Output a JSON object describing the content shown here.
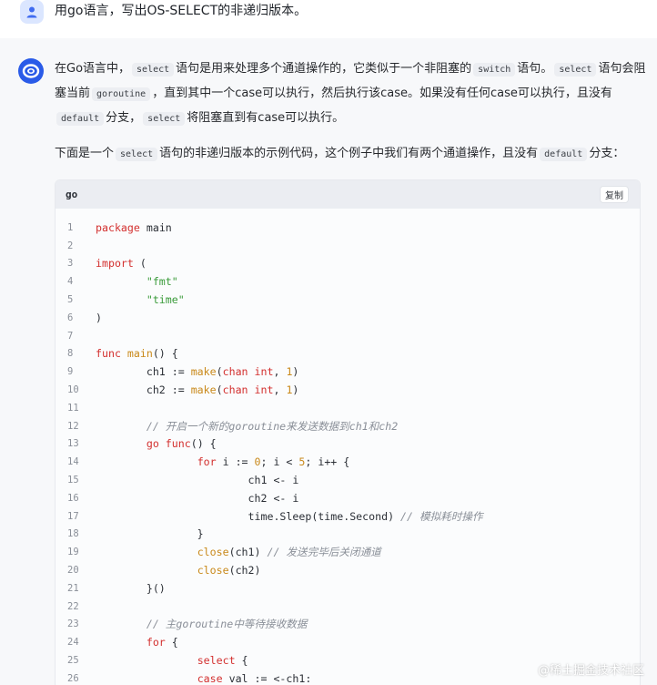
{
  "user": {
    "question": "用go语言，写出OS-SELECT的非递归版本。"
  },
  "answer": {
    "para1": [
      {
        "t": "text",
        "v": "在Go语言中，"
      },
      {
        "t": "code",
        "v": "select"
      },
      {
        "t": "text",
        "v": "语句是用来处理多个通道操作的，它类似于一个非阻塞的"
      },
      {
        "t": "code",
        "v": "switch"
      },
      {
        "t": "text",
        "v": "语句。"
      },
      {
        "t": "code",
        "v": "select"
      },
      {
        "t": "text",
        "v": "语句会阻塞当前"
      },
      {
        "t": "code",
        "v": "goroutine"
      },
      {
        "t": "text",
        "v": "，直到其中一个case可以执行，然后执行该case。如果没有任何case可以执行，且没有"
      },
      {
        "t": "code",
        "v": "default"
      },
      {
        "t": "text",
        "v": "分支，"
      },
      {
        "t": "code",
        "v": "select"
      },
      {
        "t": "text",
        "v": "将阻塞直到有case可以执行。"
      }
    ],
    "para2": [
      {
        "t": "text",
        "v": "下面是一个"
      },
      {
        "t": "code",
        "v": "select"
      },
      {
        "t": "text",
        "v": "语句的非递归版本的示例代码，这个例子中我们有两个通道操作，且没有"
      },
      {
        "t": "code",
        "v": "default"
      },
      {
        "t": "text",
        "v": "分支："
      }
    ]
  },
  "code": {
    "language": "go",
    "copy_label": "复制",
    "lines": [
      [
        {
          "c": "kw",
          "v": "package"
        },
        {
          "c": "ct",
          "v": " main"
        }
      ],
      [],
      [
        {
          "c": "kw",
          "v": "import"
        },
        {
          "c": "ct",
          "v": " ("
        }
      ],
      [
        {
          "c": "ct",
          "v": "        "
        },
        {
          "c": "str",
          "v": "\"fmt\""
        }
      ],
      [
        {
          "c": "ct",
          "v": "        "
        },
        {
          "c": "str",
          "v": "\"time\""
        }
      ],
      [
        {
          "c": "ct",
          "v": ")"
        }
      ],
      [],
      [
        {
          "c": "kw",
          "v": "func"
        },
        {
          "c": "ct",
          "v": " "
        },
        {
          "c": "fn",
          "v": "main"
        },
        {
          "c": "ct",
          "v": "() {"
        }
      ],
      [
        {
          "c": "ct",
          "v": "        ch1 := "
        },
        {
          "c": "fn",
          "v": "make"
        },
        {
          "c": "ct",
          "v": "("
        },
        {
          "c": "kw",
          "v": "chan"
        },
        {
          "c": "ct",
          "v": " "
        },
        {
          "c": "kw",
          "v": "int"
        },
        {
          "c": "ct",
          "v": ", "
        },
        {
          "c": "fn",
          "v": "1"
        },
        {
          "c": "ct",
          "v": ")"
        }
      ],
      [
        {
          "c": "ct",
          "v": "        ch2 := "
        },
        {
          "c": "fn",
          "v": "make"
        },
        {
          "c": "ct",
          "v": "("
        },
        {
          "c": "kw",
          "v": "chan"
        },
        {
          "c": "ct",
          "v": " "
        },
        {
          "c": "kw",
          "v": "int"
        },
        {
          "c": "ct",
          "v": ", "
        },
        {
          "c": "fn",
          "v": "1"
        },
        {
          "c": "ct",
          "v": ")"
        }
      ],
      [],
      [
        {
          "c": "ct",
          "v": "        "
        },
        {
          "c": "cm",
          "v": "// 开启一个新的goroutine来发送数据到ch1和ch2"
        }
      ],
      [
        {
          "c": "ct",
          "v": "        "
        },
        {
          "c": "kw",
          "v": "go"
        },
        {
          "c": "ct",
          "v": " "
        },
        {
          "c": "kw",
          "v": "func"
        },
        {
          "c": "ct",
          "v": "() {"
        }
      ],
      [
        {
          "c": "ct",
          "v": "                "
        },
        {
          "c": "kw",
          "v": "for"
        },
        {
          "c": "ct",
          "v": " i := "
        },
        {
          "c": "fn",
          "v": "0"
        },
        {
          "c": "ct",
          "v": "; i < "
        },
        {
          "c": "fn",
          "v": "5"
        },
        {
          "c": "ct",
          "v": "; i++ {"
        }
      ],
      [
        {
          "c": "ct",
          "v": "                        ch1 <- i"
        }
      ],
      [
        {
          "c": "ct",
          "v": "                        ch2 <- i"
        }
      ],
      [
        {
          "c": "ct",
          "v": "                        time.Sleep(time.Second) "
        },
        {
          "c": "cm",
          "v": "// 模拟耗时操作"
        }
      ],
      [
        {
          "c": "ct",
          "v": "                }"
        }
      ],
      [
        {
          "c": "ct",
          "v": "                "
        },
        {
          "c": "fn",
          "v": "close"
        },
        {
          "c": "ct",
          "v": "(ch1) "
        },
        {
          "c": "cm",
          "v": "// 发送完毕后关闭通道"
        }
      ],
      [
        {
          "c": "ct",
          "v": "                "
        },
        {
          "c": "fn",
          "v": "close"
        },
        {
          "c": "ct",
          "v": "(ch2)"
        }
      ],
      [
        {
          "c": "ct",
          "v": "        }()"
        }
      ],
      [],
      [
        {
          "c": "ct",
          "v": "        "
        },
        {
          "c": "cm",
          "v": "// 主goroutine中等待接收数据"
        }
      ],
      [
        {
          "c": "ct",
          "v": "        "
        },
        {
          "c": "kw",
          "v": "for"
        },
        {
          "c": "ct",
          "v": " {"
        }
      ],
      [
        {
          "c": "ct",
          "v": "                "
        },
        {
          "c": "kw",
          "v": "select"
        },
        {
          "c": "ct",
          "v": " {"
        }
      ],
      [
        {
          "c": "ct",
          "v": "                "
        },
        {
          "c": "kw",
          "v": "case"
        },
        {
          "c": "ct",
          "v": " val := <-ch1:"
        }
      ]
    ]
  },
  "watermark": "@稀土掘金技术社区"
}
